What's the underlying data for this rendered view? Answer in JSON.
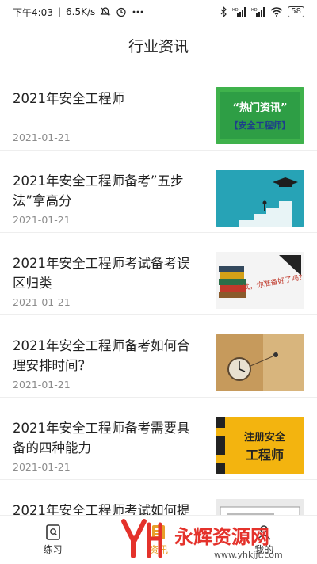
{
  "status_bar": {
    "time": "下午4:03",
    "speed": "6.5K/s",
    "battery": "58",
    "icons": [
      "mute-icon",
      "alarm-icon",
      "more-icon",
      "bluetooth-icon",
      "signal-hd-icon",
      "signal-hd-icon",
      "wifi-icon",
      "battery-icon"
    ]
  },
  "header": {
    "title": "行业资讯"
  },
  "news": [
    {
      "title": "2021年安全工程师",
      "date": "2021-01-21",
      "thumb": {
        "line1": "“热门资讯”",
        "line2": "【安全工程师】"
      }
    },
    {
      "title": "2021年安全工程师备考”五步法”拿高分",
      "date": "2021-01-21",
      "thumb": {}
    },
    {
      "title": "2021年安全工程师考试备考误区归类",
      "date": "2021-01-21",
      "thumb": {
        "line1": "考试，你准备好了吗？"
      }
    },
    {
      "title": "2021年安全工程师备考如何合理安排时间？",
      "date": "2021-01-21",
      "thumb": {}
    },
    {
      "title": "2021年安全工程师备考需要具备的四种能力",
      "date": "2021-01-21",
      "thumb": {
        "line1": "注册安全",
        "line2": "工程师"
      }
    },
    {
      "title": "2021年安全工程师考试如何提",
      "date": "",
      "thumb": {}
    }
  ],
  "tab_bar": {
    "tabs": [
      {
        "label": "练习",
        "icon": "book-icon"
      },
      {
        "label": "资讯",
        "icon": "news-icon"
      },
      {
        "label": "我的",
        "icon": "user-icon"
      }
    ]
  },
  "watermark": {
    "brand": "永辉资源网",
    "url": "www.yhkjjt.com"
  },
  "colors": {
    "accent": "#e8a02a",
    "watermark_red": "#e4322b"
  }
}
